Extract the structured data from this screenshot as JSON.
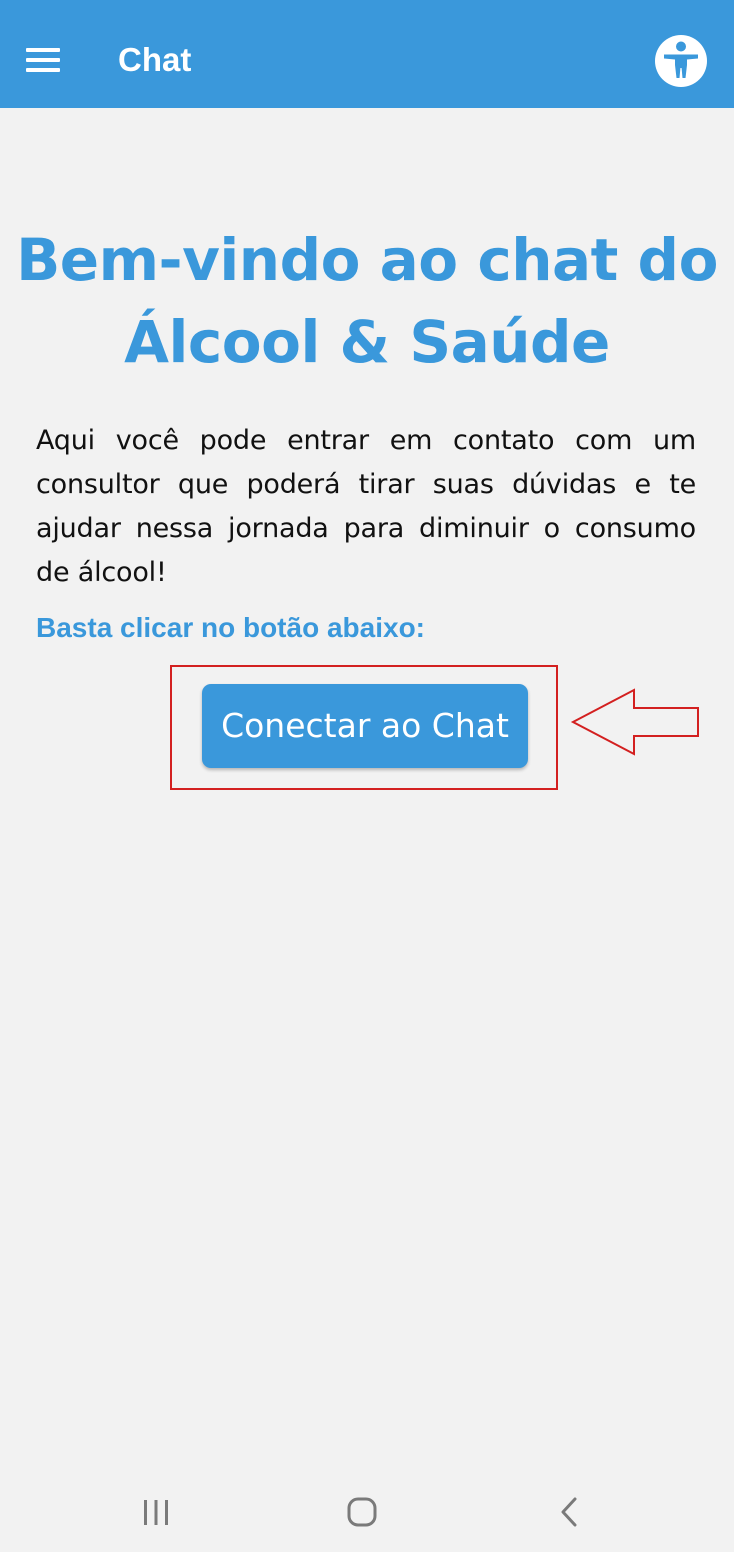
{
  "app_bar": {
    "title": "Chat",
    "menu_icon": "hamburger-menu-icon",
    "accessibility_icon": "accessibility-person-icon",
    "color": "#3a98db"
  },
  "main": {
    "welcome_line1": "Bem-vindo ao chat do",
    "welcome_line2": "Álcool & Saúde",
    "intro": "Aqui você pode entrar em contato com um consultor que poderá tirar suas dúvidas e te ajudar nessa jornada para diminuir o consumo de álcool!",
    "instruction": "Basta clicar no botão abaixo:",
    "connect_button_label": "Conectar ao Chat"
  },
  "annotation": {
    "highlight_color": "#d32020",
    "arrow_icon": "left-arrow-outline-icon"
  },
  "nav_bar": {
    "recents_icon": "recent-apps-icon",
    "home_icon": "home-icon",
    "back_icon": "back-chevron-icon"
  }
}
